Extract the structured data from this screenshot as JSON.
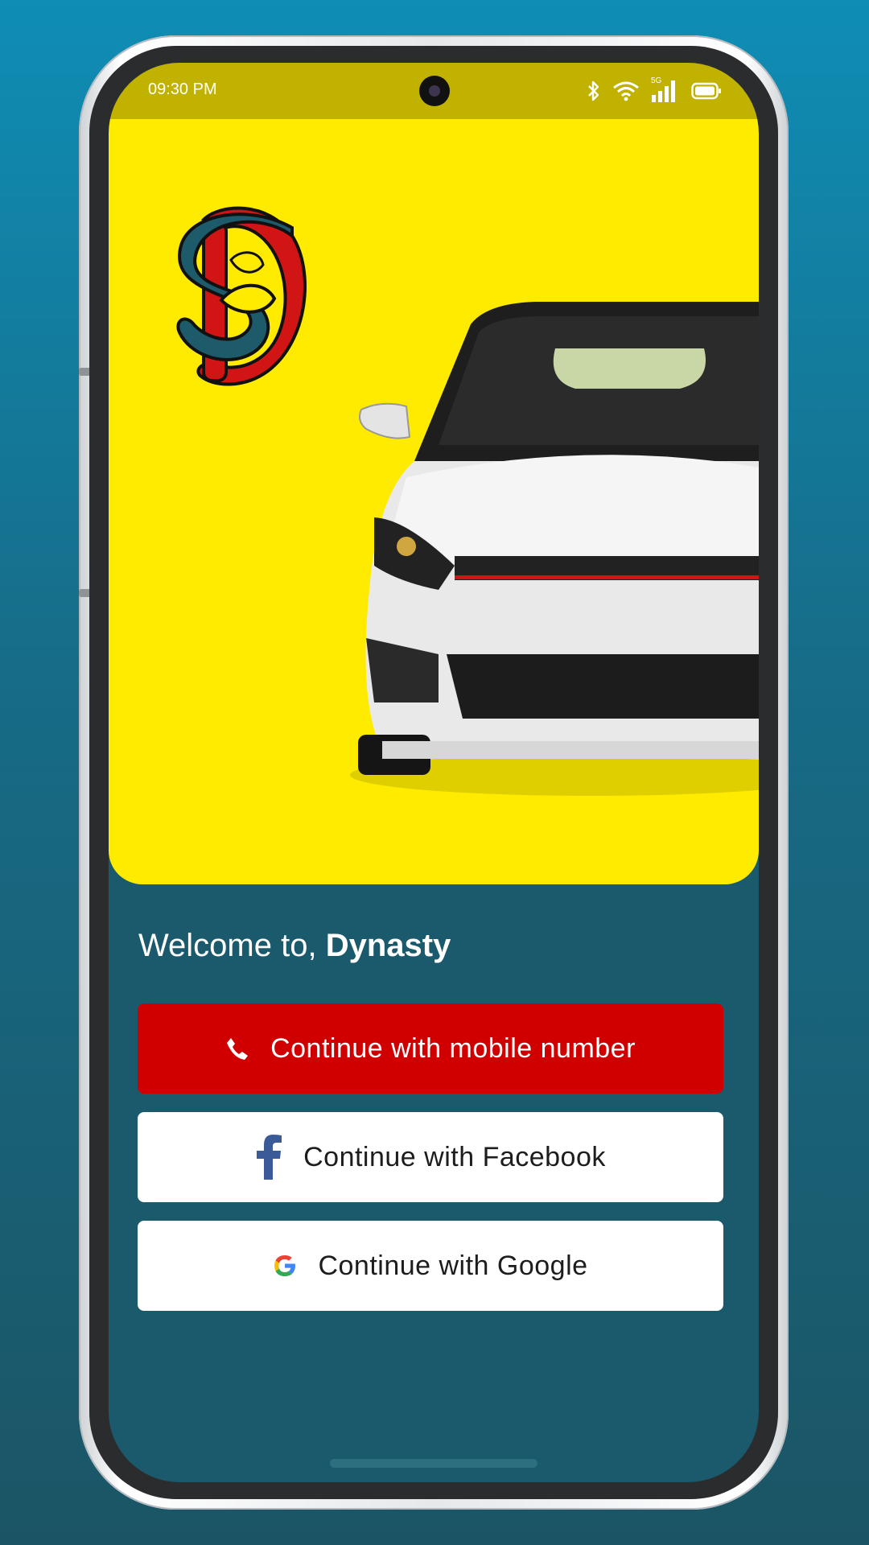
{
  "status_bar": {
    "time": "09:30 PM",
    "icons": [
      "bluetooth-icon",
      "wifi-icon",
      "signal-5g-icon",
      "battery-icon"
    ],
    "network_label": "5G"
  },
  "hero": {
    "logo": "dynasty-monogram-logo",
    "image": "white-hatchback-car",
    "background_color": "#ffeb00"
  },
  "welcome": {
    "prefix": "Welcome to,",
    "brand": "Dynasty"
  },
  "buttons": {
    "mobile": {
      "label": "Continue with mobile number",
      "icon": "phone-icon",
      "color": "#d10000"
    },
    "facebook": {
      "label": "Continue with Facebook",
      "icon": "facebook-icon"
    },
    "google": {
      "label": "Continue with Google",
      "icon": "google-icon"
    }
  },
  "colors": {
    "page_background": "#1a5a6c",
    "status_bar": "#c2b200",
    "accent": "#d10000"
  }
}
